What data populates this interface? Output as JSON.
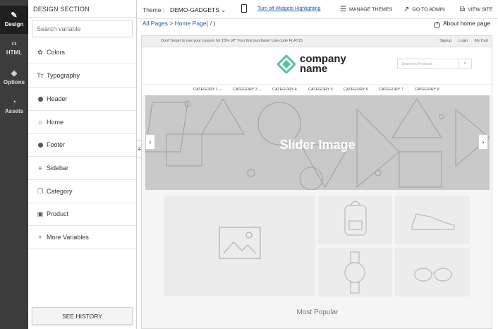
{
  "rail": {
    "items": [
      {
        "label": "Design",
        "icon": "brush-icon",
        "glyph": "✎"
      },
      {
        "label": "HTML",
        "icon": "code-icon",
        "glyph": "‹›"
      },
      {
        "label": "Options",
        "icon": "paint-bucket-icon",
        "glyph": "◈"
      },
      {
        "label": "Assets",
        "icon": "assets-icon",
        "glyph": "◔"
      }
    ]
  },
  "panel": {
    "title": "DESIGN SECTION",
    "search_placeholder": "Search variable",
    "items": [
      {
        "label": "Colors",
        "icon": "palette-icon",
        "glyph": "✿"
      },
      {
        "label": "Typography",
        "icon": "typography-icon",
        "glyph": "Tт"
      },
      {
        "label": "Header",
        "icon": "header-dot-icon",
        "glyph": ""
      },
      {
        "label": "Home",
        "icon": "home-icon",
        "glyph": "⌂"
      },
      {
        "label": "Footer",
        "icon": "footer-dot-icon",
        "glyph": ""
      },
      {
        "label": "Sidebar",
        "icon": "sidebar-list-icon",
        "glyph": "≡"
      },
      {
        "label": "Category",
        "icon": "category-icon",
        "glyph": "❐"
      },
      {
        "label": "Product",
        "icon": "product-icon",
        "glyph": "▣"
      },
      {
        "label": "More Variables",
        "icon": "plus-icon",
        "glyph": "+"
      }
    ],
    "history_label": "SEE HISTORY"
  },
  "topbar": {
    "theme_label": "Theme :",
    "theme_value": "DEMO-GADGETS ⌄",
    "highlight_link": "Turn off Widgets Highlighting",
    "manage_themes": "MANAGE THEMES",
    "go_to_admin": "GO TO ADMIN",
    "view_site": "VIEW SITE"
  },
  "breadcrumb": {
    "all_pages": "All Pages",
    "separator": ">",
    "home_page": "Home Page",
    "path": "( / )",
    "about": "About home page"
  },
  "preview": {
    "promo": "Dont' forget to use your coupon for 15% off* Your first purchase! Use code FLAT15",
    "links": [
      "Signup",
      "Login",
      "My Cart"
    ],
    "logo_line1": "company",
    "logo_line2": "name",
    "search_placeholder": "Search by Products",
    "categories": [
      "CATEGORY 1 ⌄",
      "CATEGORY 3 ⌄",
      "CATEGORY 4",
      "CATEGORY 5",
      "CATEGORY 6",
      "CATEGORY 7",
      "CATEGORY 8"
    ],
    "slider_title": "Slider Image",
    "most_popular": "Most Popular"
  },
  "colors": {
    "rail_bg": "#3c3c3c",
    "link": "#1a5db0",
    "logo_teal": "#4fc3a1"
  }
}
